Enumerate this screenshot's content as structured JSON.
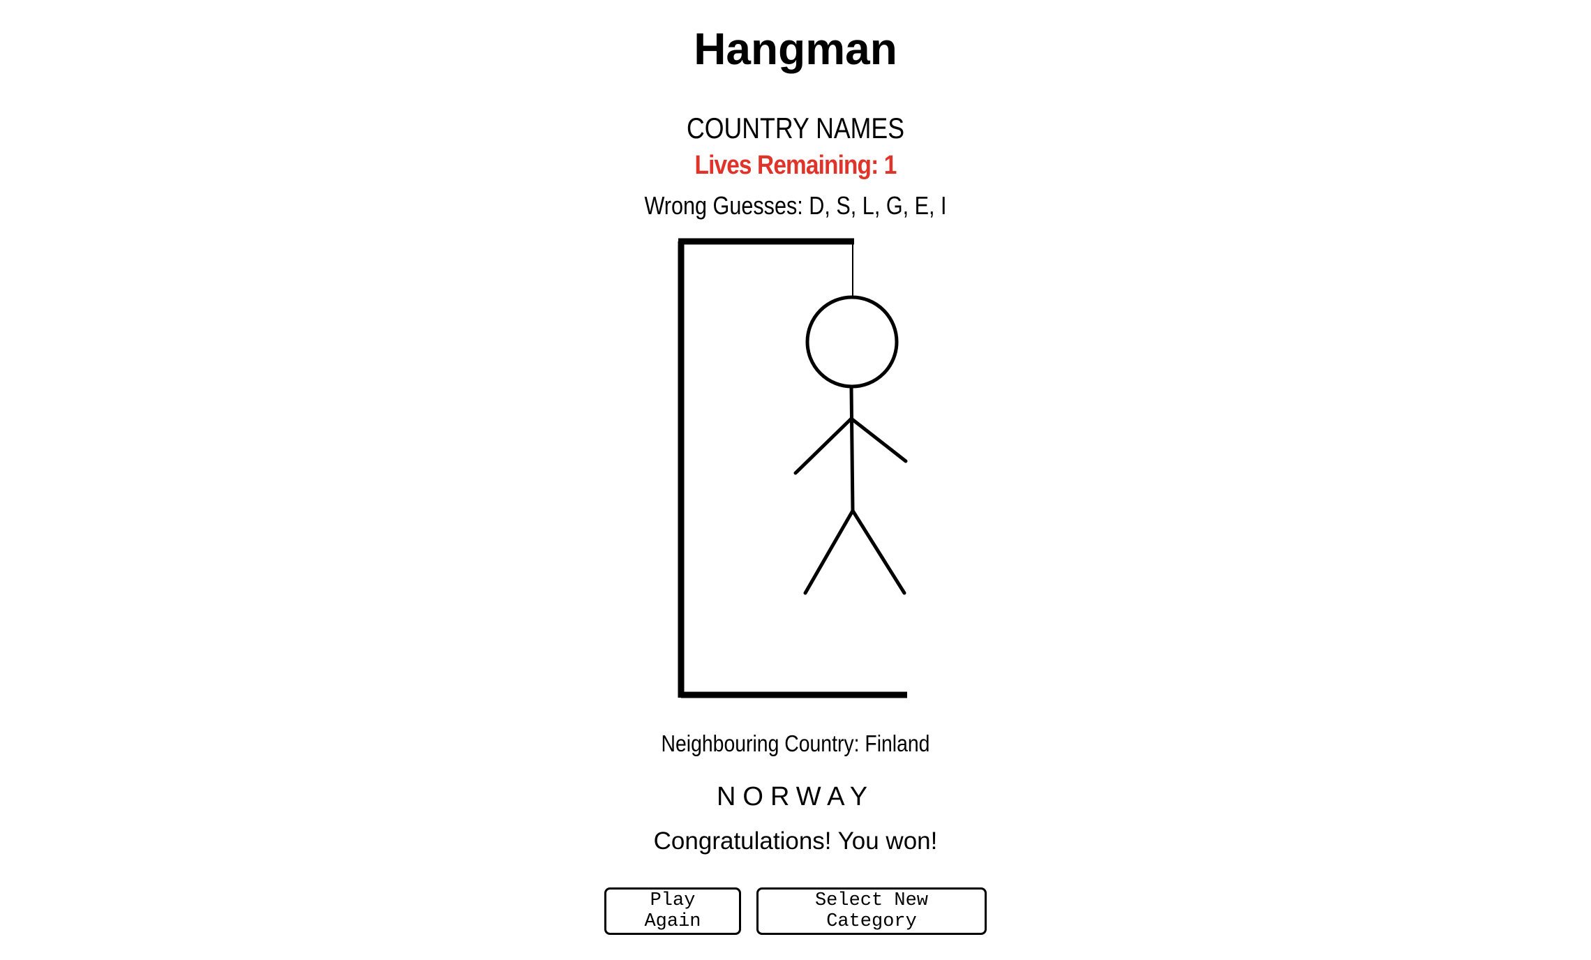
{
  "header": {
    "title": "Hangman"
  },
  "game": {
    "category": "COUNTRY NAMES",
    "lives_label": "Lives Remaining: 1",
    "lives_remaining": 1,
    "wrong_guesses_label": "Wrong Guesses: D, S, L, G, E, I",
    "wrong_guesses": [
      "D",
      "S",
      "L",
      "G",
      "E",
      "I"
    ],
    "hint": "Neighbouring Country: Finland",
    "word": "NORWAY",
    "result_message": "Congratulations! You won!"
  },
  "actions": {
    "play_again_label": "Play Again",
    "new_category_label": "Select New Category"
  },
  "colors": {
    "lives_text": "#e0342b",
    "background": "#ffffff",
    "text": "#000000"
  }
}
